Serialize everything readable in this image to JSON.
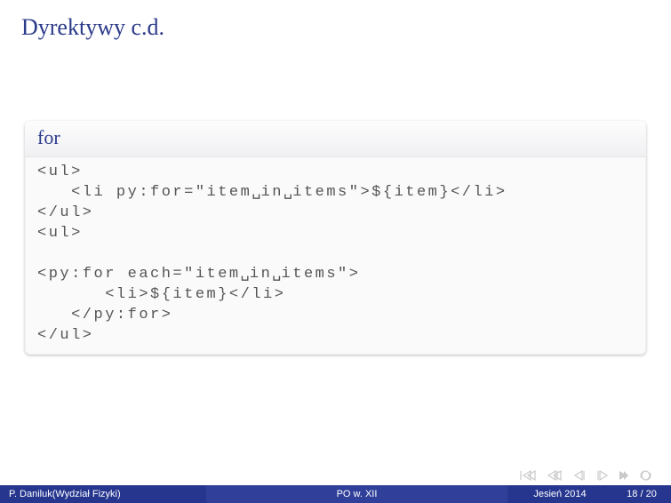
{
  "title": "Dyrektywy c.d.",
  "block": {
    "title": "for",
    "code_lines": [
      "<ul>",
      "   <li py:for=\"item␣in␣items\">${item}</li>",
      "</ul>",
      "<ul>",
      "",
      "<py:for each=\"item␣in␣items\">",
      "      <li>${item}</li>",
      "   </py:for>",
      "</ul>"
    ]
  },
  "footer": {
    "author": "P. Daniluk(Wydział Fizyki)",
    "center": "PO w. XII",
    "term": "Jesień 2014",
    "page": "18 / 20"
  },
  "nav": {
    "first": "first-slide",
    "prev": "prev-slide",
    "back": "back",
    "fwd": "forward",
    "end": "end",
    "loop": "loop"
  }
}
